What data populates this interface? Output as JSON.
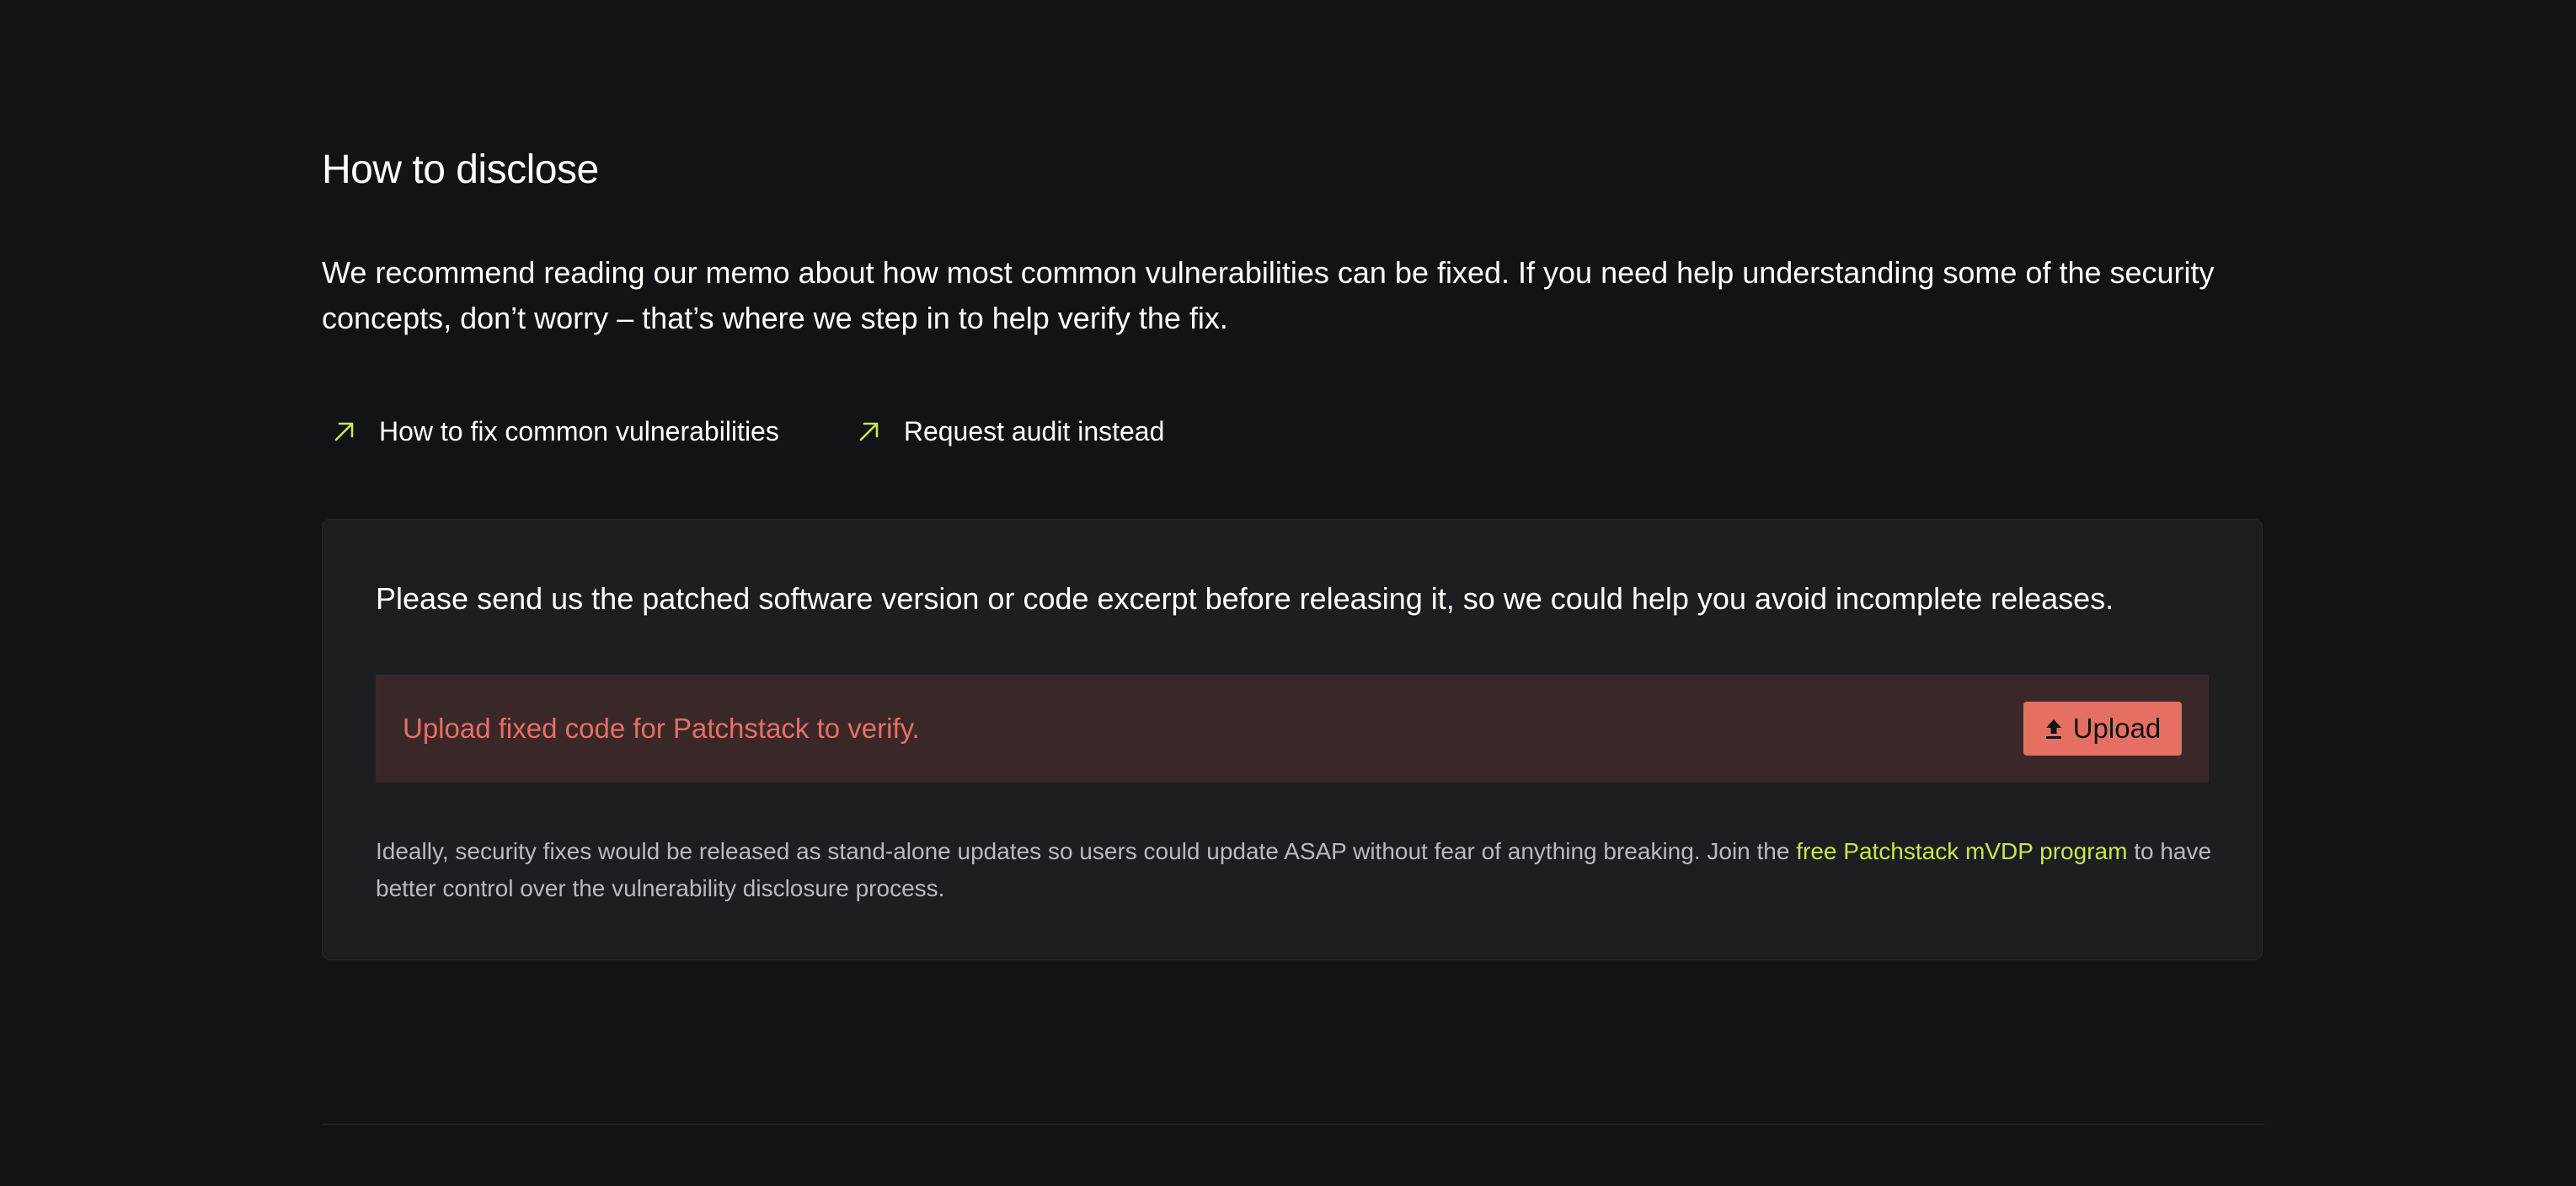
{
  "section": {
    "title": "How to disclose",
    "intro": "We recommend reading our memo about how most common vulnerabilities can be fixed. If you need help understanding some of the security concepts, don’t worry – that’s where we step in to help verify the fix."
  },
  "links": [
    {
      "label": "How to fix common vulnerabilities",
      "icon": "arrow-up-right-icon"
    },
    {
      "label": "Request audit instead",
      "icon": "arrow-up-right-icon"
    }
  ],
  "card": {
    "lead": "Please send us the patched software version or code excerpt before releasing it, so we could help you avoid incomplete releases.",
    "upload": {
      "message": "Upload fixed code for Patchstack to verify.",
      "button_label": "Upload",
      "button_icon": "upload-icon"
    },
    "note": {
      "before": "Ideally, security fixes would be released as stand-alone updates so users could update ASAP without fear of anything breaking. Join the ",
      "link": "free Patchstack mVDP program",
      "after": " to have better control over the vulnerability disclosure process."
    }
  },
  "colors": {
    "background": "#121317",
    "card": "#1d1e22",
    "accent_green": "#c5e84a",
    "alert_bg": "#3a2829",
    "alert_text": "#e66f64"
  }
}
